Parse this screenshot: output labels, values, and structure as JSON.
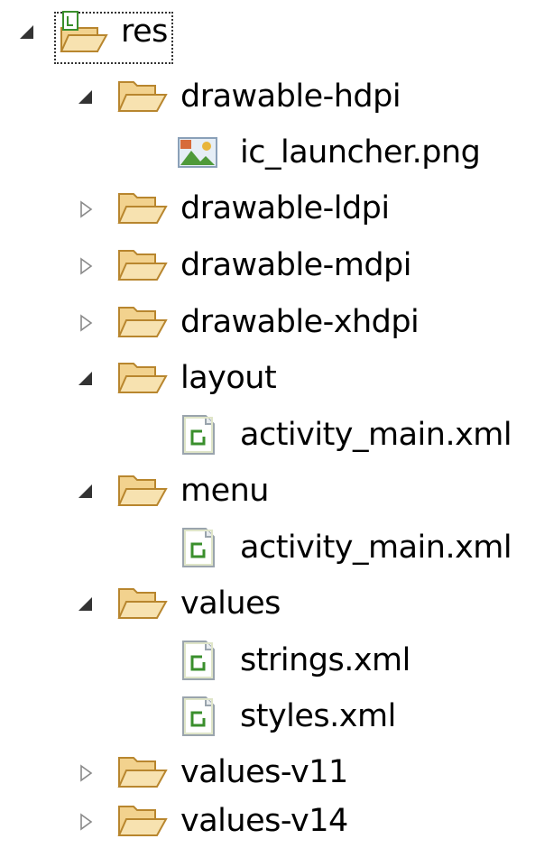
{
  "tree": {
    "root": {
      "label": "res",
      "icon": "resource-folder-icon",
      "expanded": true
    },
    "items": [
      {
        "label": "drawable-hdpi",
        "icon": "folder-icon",
        "expanded": true
      },
      {
        "label": "ic_launcher.png",
        "icon": "image-file-icon"
      },
      {
        "label": "drawable-ldpi",
        "icon": "folder-icon",
        "expanded": false
      },
      {
        "label": "drawable-mdpi",
        "icon": "folder-icon",
        "expanded": false
      },
      {
        "label": "drawable-xhdpi",
        "icon": "folder-icon",
        "expanded": false
      },
      {
        "label": "layout",
        "icon": "folder-icon",
        "expanded": true
      },
      {
        "label": "activity_main.xml",
        "icon": "xml-file-icon"
      },
      {
        "label": "menu",
        "icon": "folder-icon",
        "expanded": true
      },
      {
        "label": "activity_main.xml",
        "icon": "xml-file-icon"
      },
      {
        "label": "values",
        "icon": "folder-icon",
        "expanded": true
      },
      {
        "label": "strings.xml",
        "icon": "xml-file-icon"
      },
      {
        "label": "styles.xml",
        "icon": "xml-file-icon"
      },
      {
        "label": "values-v11",
        "icon": "folder-icon",
        "expanded": false
      },
      {
        "label": "values-v14",
        "icon": "folder-icon",
        "expanded": false
      }
    ]
  },
  "colors": {
    "folder_fill": "#f2d28e",
    "folder_stroke": "#b8862e",
    "xml_accent": "#3a8f2c",
    "twisty_expanded": "#333333",
    "twisty_collapsed": "#8a8a8a"
  }
}
